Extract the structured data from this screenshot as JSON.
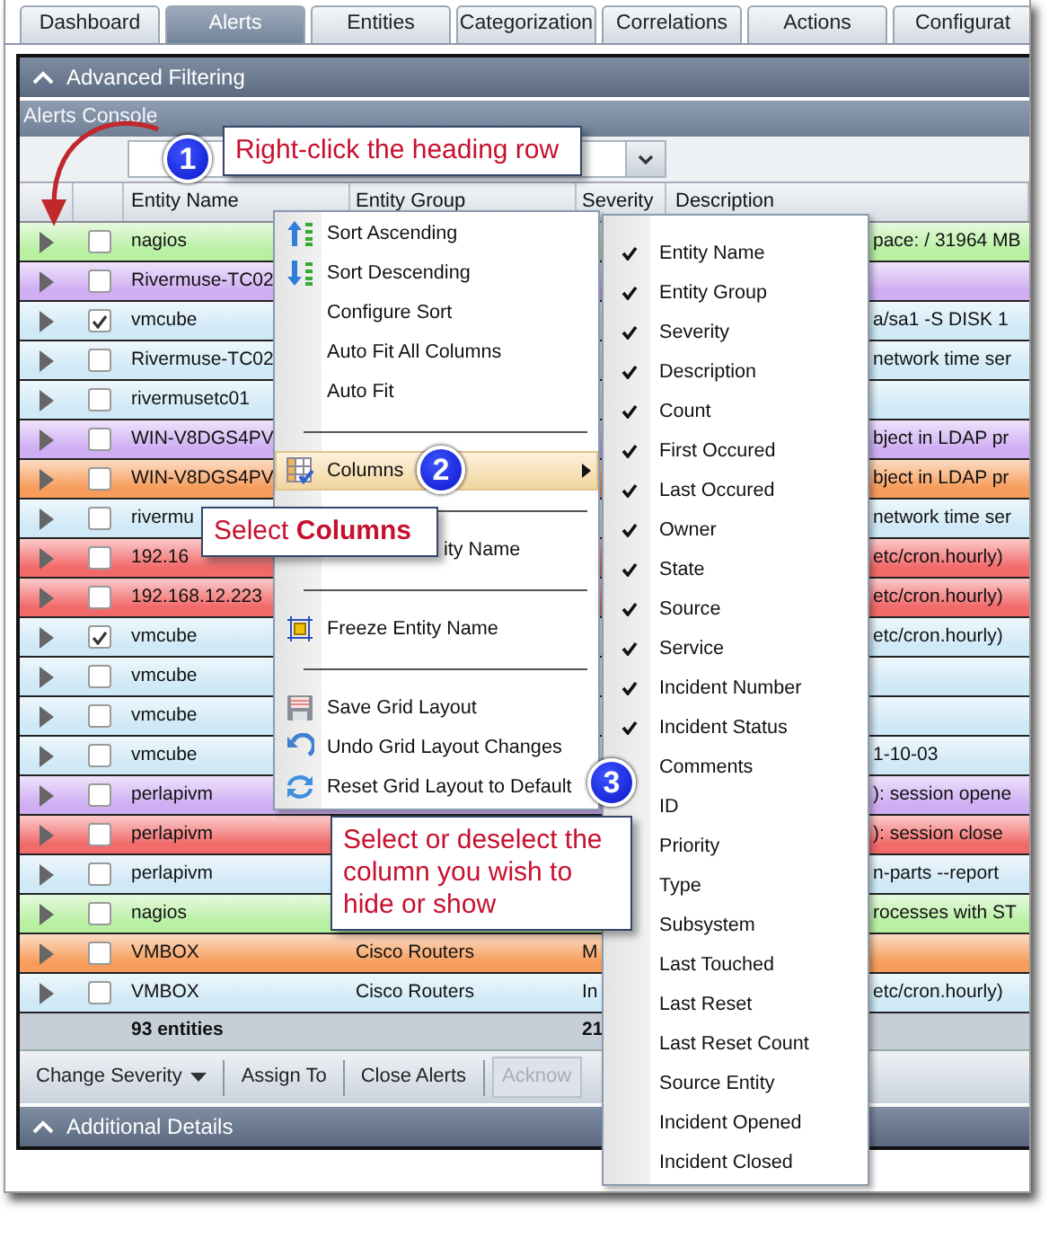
{
  "tabs": [
    {
      "label": "Dashboard",
      "selected": false
    },
    {
      "label": "Alerts",
      "selected": true
    },
    {
      "label": "Entities",
      "selected": false
    },
    {
      "label": "Categorization",
      "selected": false
    },
    {
      "label": "Correlations",
      "selected": false
    },
    {
      "label": "Actions",
      "selected": false
    },
    {
      "label": "Configurat",
      "selected": false
    }
  ],
  "advanced_filtering": {
    "title": "Advanced Filtering",
    "expanded": true
  },
  "console": {
    "title": "Alerts Console"
  },
  "grid": {
    "columns": [
      "Entity Name",
      "Entity Group",
      "Severity",
      "Description"
    ],
    "rows": [
      {
        "color": "#b8f0a2",
        "checked": false,
        "entity_name": "nagios",
        "description": "pace: / 31964 MB"
      },
      {
        "color": "#cfaef3",
        "checked": false,
        "entity_name": "Rivermuse-TC02"
      },
      {
        "color": "#cfe9f7",
        "checked": true,
        "entity_name": "vmcube",
        "description": "a/sa1 -S DISK 1"
      },
      {
        "color": "#cfe9f7",
        "checked": false,
        "entity_name": "Rivermuse-TC02",
        "description": "network time ser"
      },
      {
        "color": "#cfe9f7",
        "checked": false,
        "entity_name": "rivermusetc01"
      },
      {
        "color": "#cfaef3",
        "checked": false,
        "entity_name": "WIN-V8DGS4PV",
        "description": "bject in LDAP pr"
      },
      {
        "color": "#f79c5a",
        "checked": false,
        "entity_name": "WIN-V8DGS4PV",
        "description": "bject in LDAP pr"
      },
      {
        "color": "#cfe9f7",
        "checked": false,
        "entity_name": "rivermu",
        "description": "network time ser"
      },
      {
        "color": "#f26a6a",
        "checked": false,
        "entity_name": "192.16",
        "description": "etc/cron.hourly)"
      },
      {
        "color": "#f26a6a",
        "checked": false,
        "entity_name": "192.168.12.223",
        "description": "etc/cron.hourly)"
      },
      {
        "color": "#cfe9f7",
        "checked": true,
        "entity_name": "vmcube",
        "description": "etc/cron.hourly)"
      },
      {
        "color": "#cfe9f7",
        "checked": false,
        "entity_name": "vmcube"
      },
      {
        "color": "#cfe9f7",
        "checked": false,
        "entity_name": "vmcube"
      },
      {
        "color": "#cfe9f7",
        "checked": false,
        "entity_name": "vmcube",
        "description": "1-10-03"
      },
      {
        "color": "#cfaef3",
        "checked": false,
        "entity_name": "perlapivm",
        "description": "): session opene"
      },
      {
        "color": "#f26a6a",
        "checked": false,
        "entity_name": "perlapivm",
        "description": "): session close"
      },
      {
        "color": "#cfe9f7",
        "checked": false,
        "entity_name": "perlapivm",
        "description": "n-parts --report"
      },
      {
        "color": "#b8f0a2",
        "checked": false,
        "entity_name": "nagios",
        "description": "rocesses with ST"
      },
      {
        "color": "#f79c5a",
        "checked": false,
        "entity_name": "VMBOX",
        "entity_group": "Cisco Routers",
        "severity": "M"
      },
      {
        "color": "#cfe9f7",
        "checked": false,
        "entity_name": "VMBOX",
        "entity_group": "Cisco Routers",
        "severity": "In",
        "description": "etc/cron.hourly)"
      }
    ],
    "summary": {
      "entity_count": "93 entities",
      "severity_count": "21"
    }
  },
  "toolbar": [
    {
      "label": "Change Severity",
      "kind": "dropdown",
      "disabled": false
    },
    {
      "label": "Assign To",
      "kind": "button",
      "disabled": false
    },
    {
      "label": "Close Alerts",
      "kind": "button",
      "disabled": false
    },
    {
      "label": "Acknow",
      "kind": "button",
      "disabled": true
    }
  ],
  "additional_details": {
    "title": "Additional Details",
    "expanded": true
  },
  "context_menu": [
    {
      "kind": "item",
      "label": "Sort Ascending",
      "selected": false
    },
    {
      "kind": "item",
      "label": "Sort Descending",
      "selected": false
    },
    {
      "kind": "item",
      "label": "Configure Sort",
      "selected": false
    },
    {
      "kind": "item",
      "label": "Auto Fit All Columns",
      "selected": false
    },
    {
      "kind": "item",
      "label": "Auto Fit",
      "selected": false
    },
    {
      "kind": "separator"
    },
    {
      "kind": "submenu",
      "label": "Columns",
      "selected": true
    },
    {
      "kind": "separator"
    },
    {
      "kind": "covered",
      "label": "ity Name",
      "selected": false
    },
    {
      "kind": "separator"
    },
    {
      "kind": "item",
      "label": "Freeze Entity Name",
      "selected": false
    },
    {
      "kind": "separator"
    },
    {
      "kind": "item",
      "label": "Save Grid Layout",
      "selected": false
    },
    {
      "kind": "item",
      "label": "Undo Grid Layout Changes",
      "selected": false
    },
    {
      "kind": "item",
      "label": "Reset Grid Layout to Default",
      "selected": false
    }
  ],
  "columns_menu": [
    {
      "label": "Entity Name",
      "checked": true
    },
    {
      "label": "Entity Group",
      "checked": true
    },
    {
      "label": "Severity",
      "checked": true
    },
    {
      "label": "Description",
      "checked": true
    },
    {
      "label": "Count",
      "checked": true
    },
    {
      "label": "First Occured",
      "checked": true
    },
    {
      "label": "Last Occured",
      "checked": true
    },
    {
      "label": "Owner",
      "checked": true
    },
    {
      "label": "State",
      "checked": true
    },
    {
      "label": "Source",
      "checked": true
    },
    {
      "label": "Service",
      "checked": true
    },
    {
      "label": "Incident Number",
      "checked": true
    },
    {
      "label": "Incident Status",
      "checked": true
    },
    {
      "label": "Comments",
      "checked": false
    },
    {
      "label": "ID",
      "checked": false
    },
    {
      "label": "Priority",
      "checked": false
    },
    {
      "label": "Type",
      "checked": false
    },
    {
      "label": "Subsystem",
      "checked": false
    },
    {
      "label": "Last Touched",
      "checked": false
    },
    {
      "label": "Last Reset",
      "checked": false
    },
    {
      "label": "Last Reset Count",
      "checked": false
    },
    {
      "label": "Source Entity",
      "checked": false
    },
    {
      "label": "Incident Opened",
      "checked": false
    },
    {
      "label": "Incident Closed",
      "checked": false
    }
  ],
  "callouts": [
    {
      "number": "1",
      "text": "Right-click the heading row"
    },
    {
      "number": "2",
      "text": "Select **Columns**"
    },
    {
      "number": "3",
      "text": "Select or deselect the column you wish to hide or show"
    }
  ]
}
